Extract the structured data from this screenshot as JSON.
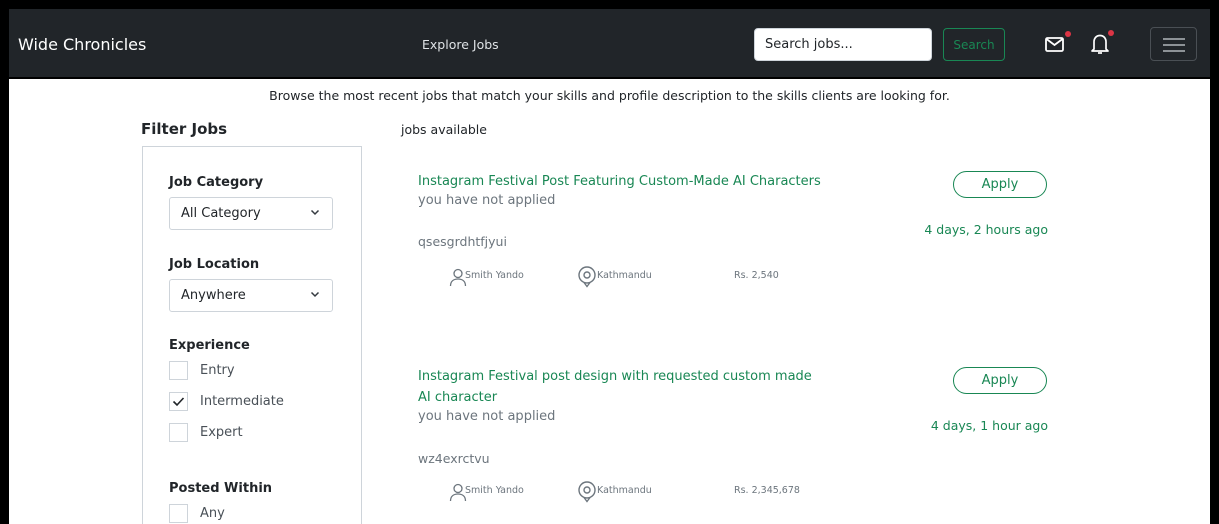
{
  "navbar": {
    "brand": "Wide Chronicles",
    "explore_link": "Explore Jobs",
    "search_placeholder": "Search jobs...",
    "search_button": "Search",
    "icons": [
      "mail-icon",
      "bell-icon",
      "menu-icon"
    ],
    "notification_color": "#dc3545"
  },
  "subtitle": "Browse the most recent jobs that match your skills and profile description to the skills clients are looking for.",
  "filter": {
    "title": "Filter Jobs",
    "category_label": "Job Category",
    "category_value": "All Category",
    "location_label": "Job Location",
    "location_value": "Anywhere",
    "experience_label": "Experience",
    "experience_options": [
      {
        "label": "Entry",
        "checked": false
      },
      {
        "label": "Intermediate",
        "checked": true
      },
      {
        "label": "Expert",
        "checked": false
      }
    ],
    "posted_label": "Posted Within",
    "posted_options": [
      {
        "label": "Any",
        "checked": false
      }
    ]
  },
  "jobs_heading": "jobs available",
  "jobs": [
    {
      "title": "Instagram Festival Post Featuring Custom-Made AI Characters",
      "status": "you have not applied",
      "code": "qsesgrdhtfjyui",
      "client": "Smith Yando",
      "location": "Kathmandu",
      "price": "Rs. 2,540",
      "apply": "Apply",
      "posted": "4 days, 2 hours ago"
    },
    {
      "title": "Instagram Festival post design with requested custom made AI character",
      "status": "you have not applied",
      "code": "wz4exrctvu",
      "client": "Smith Yando",
      "location": "Kathmandu",
      "price": "Rs. 2,345,678",
      "apply": "Apply",
      "posted": "4 days, 1 hour ago"
    }
  ],
  "colors": {
    "accent": "#198754",
    "navbar": "#212529"
  }
}
